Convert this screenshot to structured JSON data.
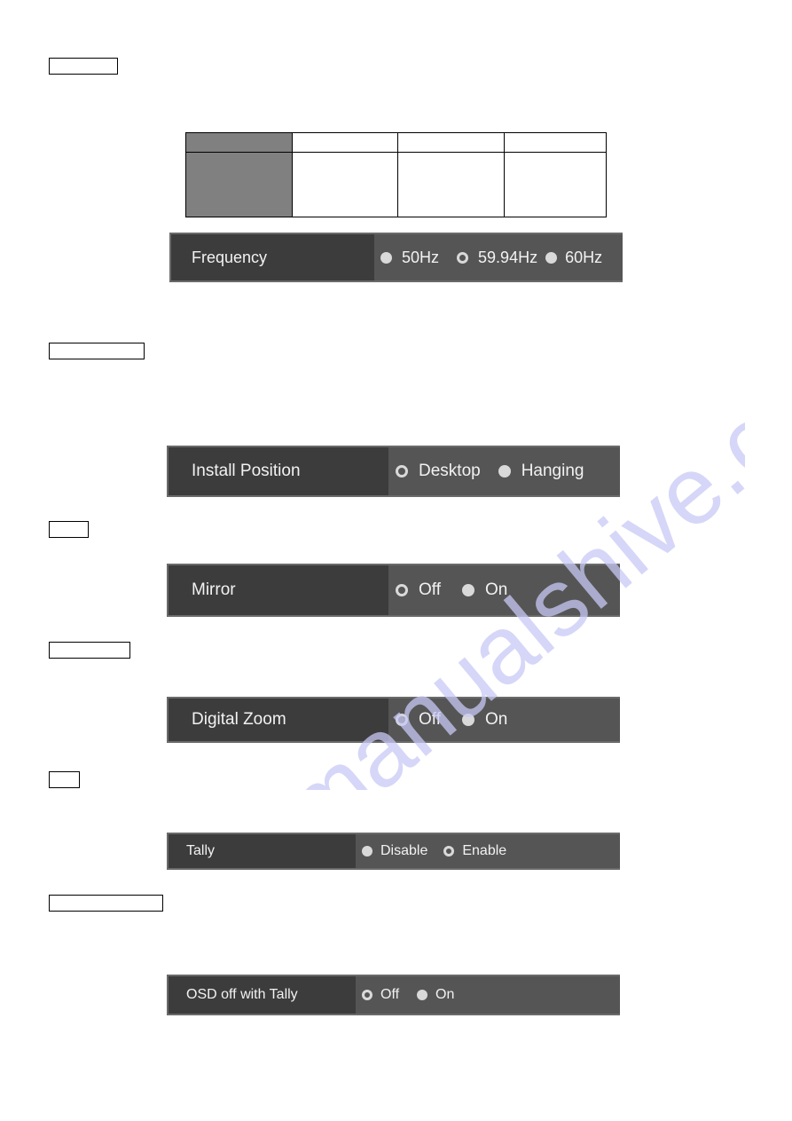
{
  "section_labels": [
    "",
    "",
    "",
    "",
    "",
    ""
  ],
  "table": {
    "header_row": [
      "",
      "",
      "",
      ""
    ],
    "body_row": [
      "",
      "",
      "",
      ""
    ]
  },
  "panels": {
    "frequency": {
      "label": "Frequency",
      "options": [
        {
          "label": "50Hz",
          "selected": false
        },
        {
          "label": "59.94Hz",
          "selected": true
        },
        {
          "label": "60Hz",
          "selected": false
        }
      ]
    },
    "install_position": {
      "label": "Install Position",
      "options": [
        {
          "label": "Desktop",
          "selected": true
        },
        {
          "label": "Hanging",
          "selected": false
        }
      ]
    },
    "mirror": {
      "label": "Mirror",
      "options": [
        {
          "label": "Off",
          "selected": true
        },
        {
          "label": "On",
          "selected": false
        }
      ]
    },
    "digital_zoom": {
      "label": "Digital Zoom",
      "options": [
        {
          "label": "Off",
          "selected": true
        },
        {
          "label": "On",
          "selected": false
        }
      ]
    },
    "tally": {
      "label": "Tally",
      "options": [
        {
          "label": "Disable",
          "selected": false
        },
        {
          "label": "Enable",
          "selected": true
        }
      ]
    },
    "osd_off_with_tally": {
      "label": "OSD off with Tally",
      "options": [
        {
          "label": "Off",
          "selected": true
        },
        {
          "label": "On",
          "selected": false
        }
      ]
    }
  },
  "watermark": "manualshive.com",
  "colors": {
    "panel_label_bg": "#3c3c3c",
    "panel_options_bg": "#555555",
    "radio": "#d9d9d9",
    "table_header": "#808080",
    "watermark": "#c8c8f5"
  }
}
